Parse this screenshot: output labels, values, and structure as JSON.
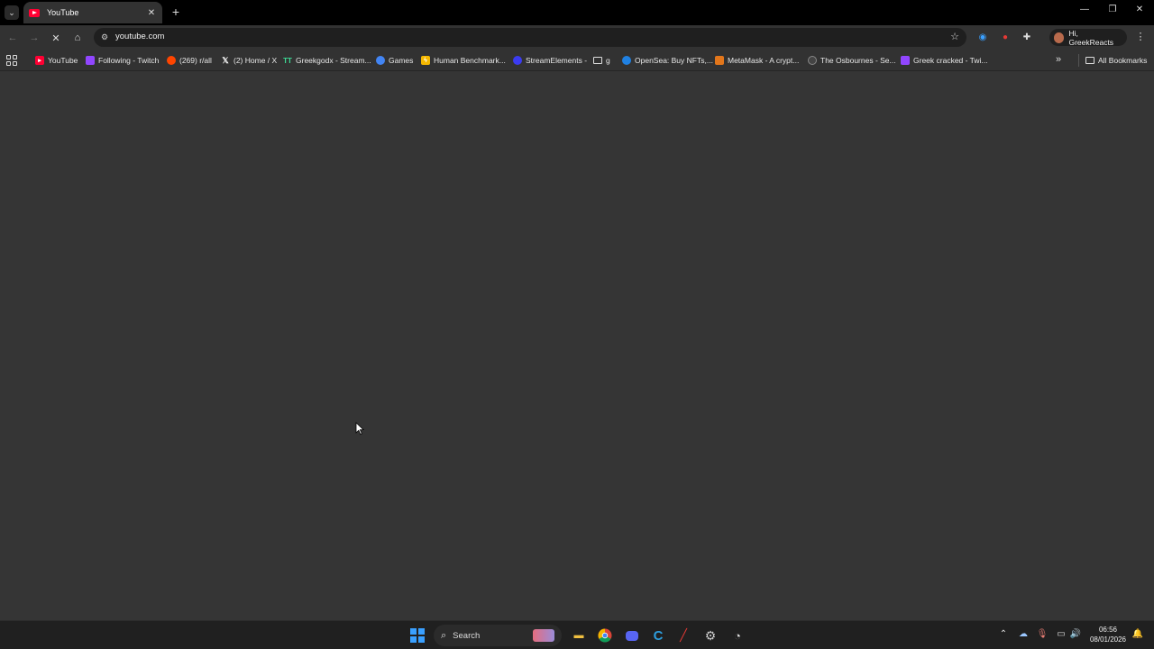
{
  "browser": {
    "tab": {
      "title": "YouTube"
    },
    "address": {
      "url": "youtube.com"
    },
    "profile": {
      "label": "Hi, GreekReacts"
    }
  },
  "bookmarks": {
    "items": [
      {
        "label": "YouTube",
        "icon": "youtube-icon",
        "color": "#ff0033"
      },
      {
        "label": "Following - Twitch",
        "icon": "twitch-icon",
        "color": "#9146ff"
      },
      {
        "label": "(269) r/all",
        "icon": "reddit-icon",
        "color": "#ff4500"
      },
      {
        "label": "(2) Home / X",
        "icon": "x-icon",
        "color": "#ffffff"
      },
      {
        "label": "Greekgodx - Stream...",
        "icon": "tt-icon",
        "color": "#3ddc97"
      },
      {
        "label": "Games",
        "icon": "games-icon",
        "color": "#4285f4"
      },
      {
        "label": "Human Benchmark...",
        "icon": "lightning-icon",
        "color": "#f5b800"
      },
      {
        "label": "StreamElements -",
        "icon": "streamelements-icon",
        "color": "#3b3bf0"
      },
      {
        "label": "g",
        "icon": "folder-icon",
        "color": "#dddddd"
      },
      {
        "label": "OpenSea: Buy NFTs,...",
        "icon": "opensea-icon",
        "color": "#2081e2"
      },
      {
        "label": "MetaMask - A crypt...",
        "icon": "metamask-icon",
        "color": "#e2761b"
      },
      {
        "label": "The Osbournes - Se...",
        "icon": "osbournes-icon",
        "color": "#444444"
      },
      {
        "label": "Greek cracked - Twi...",
        "icon": "twitch-icon",
        "color": "#9146ff"
      }
    ],
    "all_label": "All Bookmarks"
  },
  "taskbar": {
    "search_label": "Search",
    "time": "06:56",
    "date": "08/01/2026"
  }
}
